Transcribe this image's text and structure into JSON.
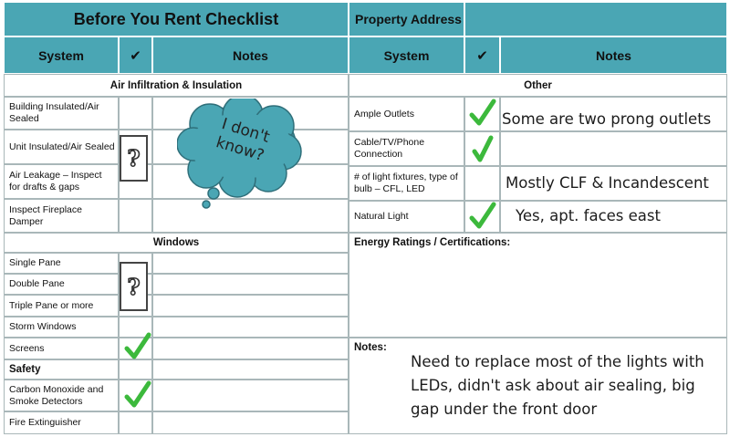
{
  "header": {
    "title": "Before You Rent Checklist",
    "property_address_label": "Property Address",
    "left_columns": {
      "system": "System",
      "check": "✔",
      "notes": "Notes"
    },
    "right_columns": {
      "system": "System",
      "check": "✔",
      "notes": "Notes"
    }
  },
  "left": {
    "air_section": "Air Infiltration & Insulation",
    "air_items": [
      "Building Insulated/Air Sealed",
      "Unit Insulated/Air Sealed",
      "Air Leakage – Inspect for drafts & gaps",
      "Inspect Fireplace Damper"
    ],
    "windows_section": "Windows",
    "window_items": [
      "Single Pane",
      "Double Pane",
      "Triple Pane or more",
      "Storm Windows",
      "Screens"
    ],
    "safety_section": "Safety",
    "safety_items": [
      "Carbon Monoxide and Smoke Detectors",
      "Fire Extinguisher"
    ],
    "question_mark": "?",
    "cloud_note": "I don't know?"
  },
  "right": {
    "other_section": "Other",
    "other_items": [
      {
        "system": "Ample Outlets",
        "checked": true,
        "note": "Some are two prong outlets"
      },
      {
        "system": "Cable/TV/Phone Connection",
        "checked": true,
        "note": ""
      },
      {
        "system": "# of light fixtures, type of bulb – CFL, LED",
        "checked": false,
        "note": "Mostly CLF & Incandescent"
      },
      {
        "system": "Natural Light",
        "checked": true,
        "note": "Yes, apt. faces east"
      }
    ],
    "energy_label": "Energy Ratings / Certifications:",
    "notes_label": "Notes:",
    "notes_text": "Need to replace most of the lights with LEDs, didn't ask about air sealing, big gap under the front door"
  },
  "colors": {
    "header": "#4aa6b4",
    "check": "#3cb93c",
    "cloud": "#4aa6b4"
  }
}
